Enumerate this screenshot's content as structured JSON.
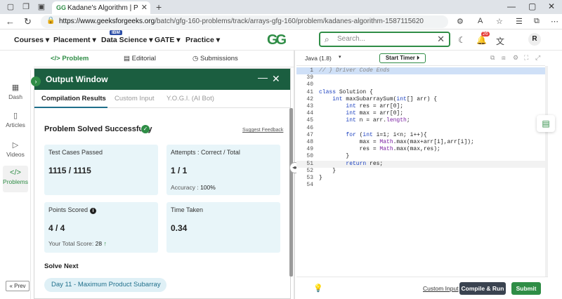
{
  "browser": {
    "tab_title": "Kadane's Algorithm | Practice | Ge",
    "tab_favicon": "GG",
    "url_host": "https://www.geeksforgeeks.org",
    "url_path": "/batch/gfg-160-problems/track/arrays-gfg-160/problem/kadanes-algorithm-1587115620",
    "icons": [
      "back-icon",
      "refresh-icon",
      "lock-icon",
      "star-icon",
      "extensions-icon",
      "more-icon"
    ]
  },
  "header": {
    "menu": [
      "Courses",
      "Placement",
      "Data Science",
      "GATE",
      "Practice"
    ],
    "ibm_badge": "IBM",
    "logo": "GG",
    "search_placeholder": "Search...",
    "notification_count": "26",
    "avatar": "R"
  },
  "rail": {
    "items": [
      {
        "label": "Dash",
        "icon": "grid-icon"
      },
      {
        "label": "Articles",
        "icon": "book-icon"
      },
      {
        "label": "Videos",
        "icon": "video-icon"
      },
      {
        "label": "Problems",
        "icon": "code-icon"
      }
    ],
    "prev_label": "Prev"
  },
  "problem_tabs": {
    "problem": "Problem",
    "editorial": "Editorial",
    "submissions": "Submissions"
  },
  "output_window": {
    "title": "Output Window",
    "tabs": [
      "Compilation Results",
      "Custom Input",
      "Y.O.G.I. (AI Bot)"
    ],
    "status": "Problem Solved Successfully",
    "suggest_feedback": "Suggest Feedback",
    "cards": {
      "test_cases_label": "Test Cases Passed",
      "test_cases_value": "1115 / 1115",
      "attempts_label": "Attempts : Correct / Total",
      "attempts_value": "1 / 1",
      "accuracy_label": "Accuracy :",
      "accuracy_value": "100%",
      "points_label": "Points Scored",
      "points_value": "4 / 4",
      "total_score_label": "Your Total Score:",
      "total_score_value": "28",
      "time_label": "Time Taken",
      "time_value": "0.34"
    },
    "solve_next_label": "Solve Next",
    "solve_next_item": "Day 11 - Maximum Product Subarray"
  },
  "editor": {
    "language": "Java (1.8)",
    "start_timer": "Start Timer",
    "lines": [
      {
        "n": "1",
        "t": "// } Driver Code Ends",
        "style": "hl"
      },
      {
        "n": "39",
        "t": "",
        "style": ""
      },
      {
        "n": "40",
        "t": "",
        "style": ""
      },
      {
        "n": "41",
        "t": "class Solution {",
        "style": ""
      },
      {
        "n": "42",
        "t": "    int maxSubarraySum(int[] arr) {",
        "style": ""
      },
      {
        "n": "43",
        "t": "        int res = arr[0];",
        "style": ""
      },
      {
        "n": "44",
        "t": "        int max = arr[0];",
        "style": ""
      },
      {
        "n": "45",
        "t": "        int n = arr.length;",
        "style": ""
      },
      {
        "n": "46",
        "t": "",
        "style": ""
      },
      {
        "n": "47",
        "t": "        for (int i=1; i<n; i++){",
        "style": ""
      },
      {
        "n": "48",
        "t": "            max = Math.max(max+arr[i],arr[i]);",
        "style": ""
      },
      {
        "n": "49",
        "t": "            res = Math.max(max,res);",
        "style": ""
      },
      {
        "n": "50",
        "t": "        }",
        "style": ""
      },
      {
        "n": "51",
        "t": "        return res;",
        "style": "cur"
      },
      {
        "n": "52",
        "t": "    }",
        "style": ""
      },
      {
        "n": "53",
        "t": "}",
        "style": ""
      },
      {
        "n": "54",
        "t": "",
        "style": ""
      }
    ],
    "custom_input": "Custom Input",
    "compile_run": "Compile & Run",
    "submit": "Submit"
  }
}
